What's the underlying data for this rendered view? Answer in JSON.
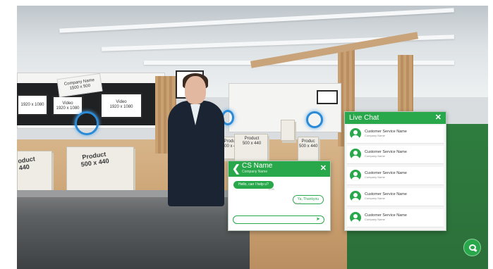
{
  "scene": {
    "booth_sign_main": "Company Name\n1500 x 500",
    "screen_small_1": "1920 x 1080",
    "screen_small_2": "Video\n1920 x 1080",
    "screen_small_3": "Video\n1920 x 1080",
    "product_box_1": "Product\n500 x 440",
    "product_box_2": "Product\n500 x 440",
    "product_box_left": "oduct\n440",
    "product_box_small": "Product\n500 x 440",
    "product_box_right": "Produc\n500 x 440"
  },
  "cs_chat": {
    "name": "CS Name",
    "company": "Company Name",
    "back_icon": "chevron-left-icon",
    "close_icon": "close-icon",
    "messages": [
      {
        "from": "agent",
        "text": "Hello, can I help u?",
        "time": "10:00"
      },
      {
        "from": "user",
        "text": "Ya, Thankyou",
        "time": "10:00"
      }
    ],
    "input_value": "",
    "send_icon": "send-icon"
  },
  "live_chat": {
    "title": "Live Chat",
    "close_icon": "close-icon",
    "items": [
      {
        "name": "Customer Service Name",
        "company": "Company Name"
      },
      {
        "name": "Customer Service Name",
        "company": "Company Name"
      },
      {
        "name": "Customer Service Name",
        "company": "Company Name"
      },
      {
        "name": "Customer Service Name",
        "company": "Company Name"
      },
      {
        "name": "Customer Service Name",
        "company": "Company Name"
      }
    ]
  },
  "fab": {
    "icon": "chat-bubble-icon"
  },
  "colors": {
    "accent": "#29a84b"
  }
}
